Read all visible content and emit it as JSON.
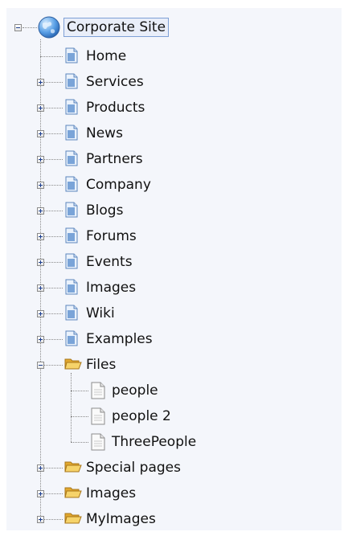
{
  "tree": {
    "root": {
      "label": "Corporate Site",
      "icon": "globe-icon",
      "expanded": true,
      "selected": true
    },
    "items": [
      {
        "label": "Home",
        "icon": "page-icon",
        "expandable": false
      },
      {
        "label": "Services",
        "icon": "page-icon",
        "expandable": true,
        "expanded": false
      },
      {
        "label": "Products",
        "icon": "page-icon",
        "expandable": true,
        "expanded": false
      },
      {
        "label": "News",
        "icon": "page-icon",
        "expandable": true,
        "expanded": false
      },
      {
        "label": "Partners",
        "icon": "page-icon",
        "expandable": true,
        "expanded": false
      },
      {
        "label": "Company",
        "icon": "page-icon",
        "expandable": true,
        "expanded": false
      },
      {
        "label": "Blogs",
        "icon": "page-icon",
        "expandable": true,
        "expanded": false
      },
      {
        "label": "Forums",
        "icon": "page-icon",
        "expandable": true,
        "expanded": false
      },
      {
        "label": "Events",
        "icon": "page-icon",
        "expandable": true,
        "expanded": false
      },
      {
        "label": "Images",
        "icon": "page-icon",
        "expandable": true,
        "expanded": false
      },
      {
        "label": "Wiki",
        "icon": "page-icon",
        "expandable": true,
        "expanded": false
      },
      {
        "label": "Examples",
        "icon": "page-icon",
        "expandable": true,
        "expanded": false
      },
      {
        "label": "Files",
        "icon": "folder-open-icon",
        "expandable": true,
        "expanded": true,
        "children": [
          {
            "label": "people",
            "icon": "file-icon"
          },
          {
            "label": "people 2",
            "icon": "file-icon"
          },
          {
            "label": "ThreePeople",
            "icon": "file-icon"
          }
        ]
      },
      {
        "label": "Special pages",
        "icon": "folder-open-icon",
        "expandable": true,
        "expanded": false
      },
      {
        "label": "Images",
        "icon": "folder-open-icon",
        "expandable": true,
        "expanded": false
      },
      {
        "label": "MyImages",
        "icon": "folder-open-icon",
        "expandable": true,
        "expanded": false
      }
    ]
  },
  "colors": {
    "background": "#f4f6fb",
    "selection_bg": "#e9eef9",
    "selection_border": "#7ea0d6",
    "tree_lines": "#8a8a8a",
    "folder": "#f0c24a",
    "page": "#7aa4d8"
  }
}
